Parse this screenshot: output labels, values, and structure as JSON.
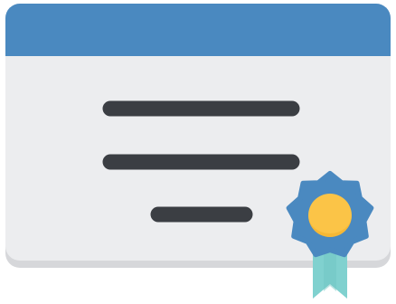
{
  "illustration": {
    "icon": "certificate-icon",
    "colors": {
      "header": "#4a89c0",
      "card_body": "#ecedef",
      "card_shadow": "#d6d7da",
      "text_lines": "#3b3e43",
      "badge_outer": "#4a89c0",
      "badge_inner": "#fbc447",
      "ribbon": "#80d1cf"
    }
  }
}
